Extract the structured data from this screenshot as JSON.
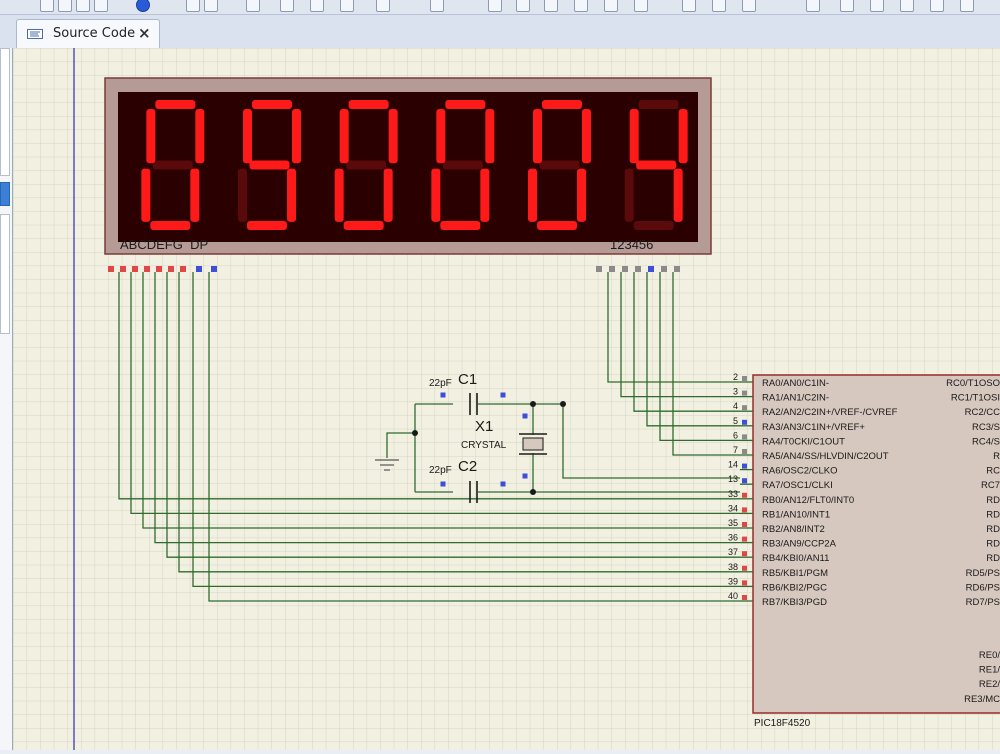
{
  "tab": {
    "label": "Source Code",
    "close": "×"
  },
  "display": {
    "digits": [
      "0",
      "9",
      "0",
      "0",
      "0",
      "4"
    ],
    "segment_label": "ABCDEFG  DP",
    "digit_label": "123456",
    "lit_color": "#ff1a1a",
    "unlit_color": "#5a0a0a"
  },
  "components": {
    "c1": {
      "ref": "C1",
      "value": "22pF"
    },
    "c2": {
      "ref": "C2",
      "value": "22pF"
    },
    "x1": {
      "ref": "X1",
      "value": "CRYSTAL"
    }
  },
  "mcu": {
    "name": "PIC18F4520",
    "left_pins": [
      {
        "num": "2",
        "label": "RA0/AN0/C1IN-"
      },
      {
        "num": "3",
        "label": "RA1/AN1/C2IN-"
      },
      {
        "num": "4",
        "label": "RA2/AN2/C2IN+/VREF-/CVREF"
      },
      {
        "num": "5",
        "label": "RA3/AN3/C1IN+/VREF+"
      },
      {
        "num": "6",
        "label": "RA4/T0CKI/C1OUT"
      },
      {
        "num": "7",
        "label": "RA5/AN4/SS/HLVDIN/C2OUT"
      },
      {
        "num": "14",
        "label": "RA6/OSC2/CLKO"
      },
      {
        "num": "13",
        "label": "RA7/OSC1/CLKI"
      },
      {
        "num": "33",
        "label": "RB0/AN12/FLT0/INT0"
      },
      {
        "num": "34",
        "label": "RB1/AN10/INT1"
      },
      {
        "num": "35",
        "label": "RB2/AN8/INT2"
      },
      {
        "num": "36",
        "label": "RB3/AN9/CCP2A"
      },
      {
        "num": "37",
        "label": "RB4/KBI0/AN11"
      },
      {
        "num": "38",
        "label": "RB5/KBI1/PGM"
      },
      {
        "num": "39",
        "label": "RB6/KBI2/PGC"
      },
      {
        "num": "40",
        "label": "RB7/KBI3/PGD"
      }
    ],
    "right_pins": [
      "RC0/T1OSO",
      "RC1/T1OSI",
      "RC2/CC",
      "RC3/S",
      "RC4/S",
      "R",
      "RC",
      "RC7",
      "RD",
      "RD",
      "RD",
      "RD",
      "RD",
      "RD5/PS",
      "RD6/PS",
      "RD7/PS",
      "RE0/",
      "RE1/",
      "RE2/",
      "RE3/MC"
    ]
  },
  "colors": {
    "grid_bg": "#f2f0e1",
    "grid_line": "#d6d4c4",
    "wire": "#2f6b2f",
    "chip_fill": "#d6c8bf",
    "chip_border": "#9b2b2b",
    "pin_red": "#e04848",
    "pin_blue": "#3b4fd8",
    "pin_gray": "#8a8a8a"
  }
}
